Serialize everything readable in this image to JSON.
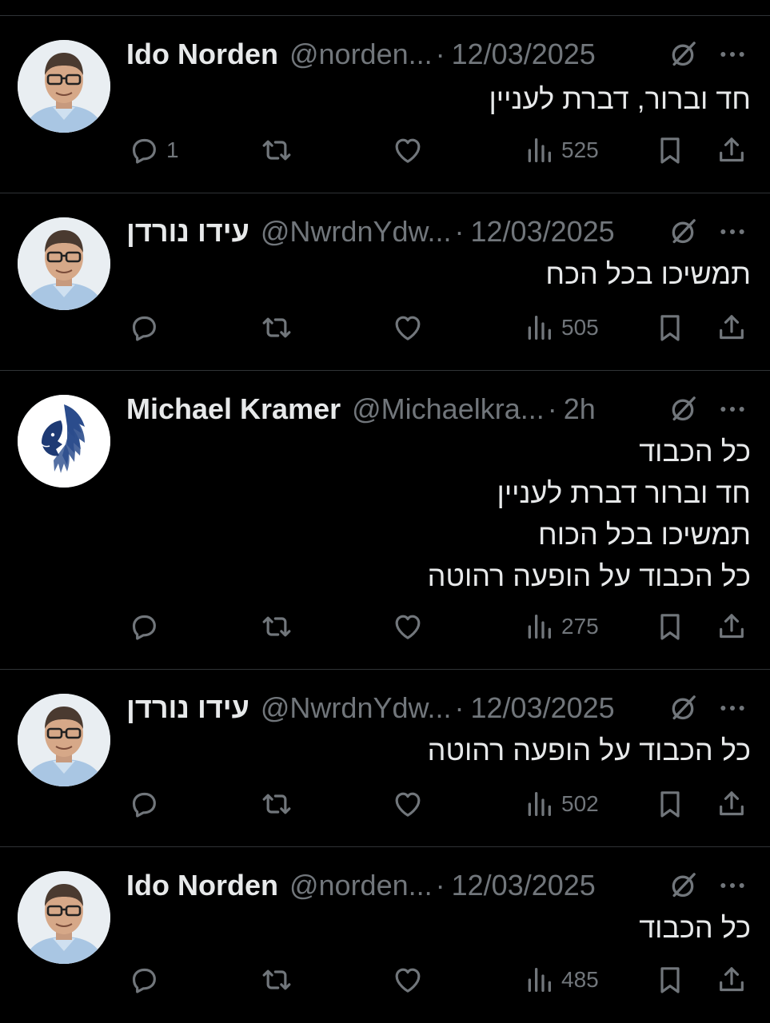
{
  "colors": {
    "background": "#000000",
    "text_primary": "#e7e9ea",
    "text_secondary": "#71767b",
    "divider": "#2f3336"
  },
  "header_separator": "·",
  "tweets": [
    {
      "display_name": "Ido Norden",
      "handle": "@norden...",
      "timestamp": "12/03/2025",
      "avatar": "person-photo",
      "lines": [
        "חד וברור, דברת לעניין"
      ],
      "reply_count": "1",
      "repost_count": "",
      "like_count": "",
      "view_count": "525"
    },
    {
      "display_name": "עידו נורדן",
      "handle": "@NwrdnYdw...",
      "timestamp": "12/03/2025",
      "avatar": "person-photo",
      "lines": [
        "תמשיכו בכל הכח"
      ],
      "reply_count": "",
      "repost_count": "",
      "like_count": "",
      "view_count": "505"
    },
    {
      "display_name": "Michael Kramer",
      "handle": "@Michaelkra...",
      "timestamp": "2h",
      "avatar": "lion-logo",
      "lines": [
        "כל הכבוד",
        "חד וברור דברת לעניין",
        "תמשיכו בכל הכוח",
        "כל הכבוד על הופעה רהוטה"
      ],
      "reply_count": "",
      "repost_count": "",
      "like_count": "",
      "view_count": "275"
    },
    {
      "display_name": "עידו נורדן",
      "handle": "@NwrdnYdw...",
      "timestamp": "12/03/2025",
      "avatar": "person-photo",
      "lines": [
        "כל הכבוד על הופעה רהוטה"
      ],
      "reply_count": "",
      "repost_count": "",
      "like_count": "",
      "view_count": "502"
    },
    {
      "display_name": "Ido Norden",
      "handle": "@norden...",
      "timestamp": "12/03/2025",
      "avatar": "person-photo",
      "lines": [
        "כל הכבוד"
      ],
      "reply_count": "",
      "repost_count": "",
      "like_count": "",
      "view_count": "485"
    }
  ],
  "icons": {
    "reply": "reply-icon",
    "repost": "repost-icon",
    "like": "like-icon",
    "views": "views-icon",
    "bookmark": "bookmark-icon",
    "share": "share-icon",
    "grok": "grok-icon",
    "more": "more-icon"
  }
}
